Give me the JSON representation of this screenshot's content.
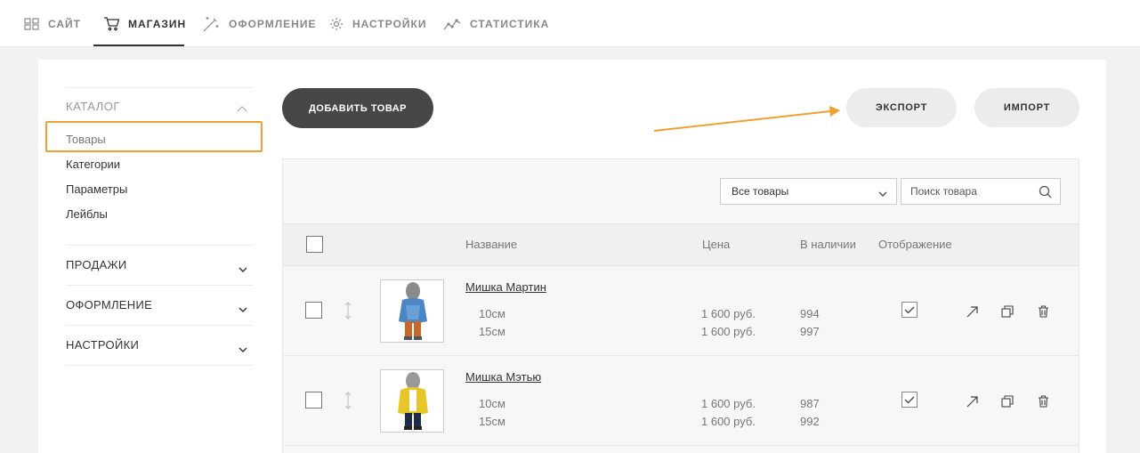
{
  "nav": {
    "items": [
      {
        "label": "САЙТ",
        "icon": "grid-icon"
      },
      {
        "label": "МАГАЗИН",
        "icon": "cart-icon",
        "active": true
      },
      {
        "label": "ОФОРМЛЕНИЕ",
        "icon": "magic-wand-icon"
      },
      {
        "label": "НАСТРОЙКИ",
        "icon": "gear-icon"
      },
      {
        "label": "СТАТИСТИКА",
        "icon": "chart-line-icon"
      }
    ]
  },
  "sidebar": {
    "catalog_label": "КАТАЛОГ",
    "catalog_items": [
      "Товары",
      "Категории",
      "Параметры",
      "Лейблы"
    ],
    "sections": [
      "ПРОДАЖИ",
      "ОФОРМЛЕНИЕ",
      "НАСТРОЙКИ"
    ]
  },
  "toolbar": {
    "add_label": "ДОБАВИТЬ ТОВАР",
    "export_label": "ЭКСПОРТ",
    "import_label": "ИМПОРТ"
  },
  "filters": {
    "select_value": "Все товары",
    "search_placeholder": "Поиск товара"
  },
  "table": {
    "headers": {
      "name": "Название",
      "price": "Цена",
      "stock": "В наличии",
      "display": "Отображение"
    },
    "rows": [
      {
        "name": "Мишка Мартин",
        "variants": [
          {
            "size": "10см",
            "price": "1 600 руб.",
            "stock": "994"
          },
          {
            "size": "15см",
            "price": "1 600 руб.",
            "stock": "997"
          }
        ],
        "visible": true
      },
      {
        "name": "Мишка Мэтью",
        "variants": [
          {
            "size": "10см",
            "price": "1 600 руб.",
            "stock": "987"
          },
          {
            "size": "15см",
            "price": "1 600 руб.",
            "stock": "992"
          }
        ],
        "visible": true
      }
    ]
  },
  "colors": {
    "accent": "#f0a030",
    "dark_button": "#474747",
    "light_button": "#ececec"
  }
}
